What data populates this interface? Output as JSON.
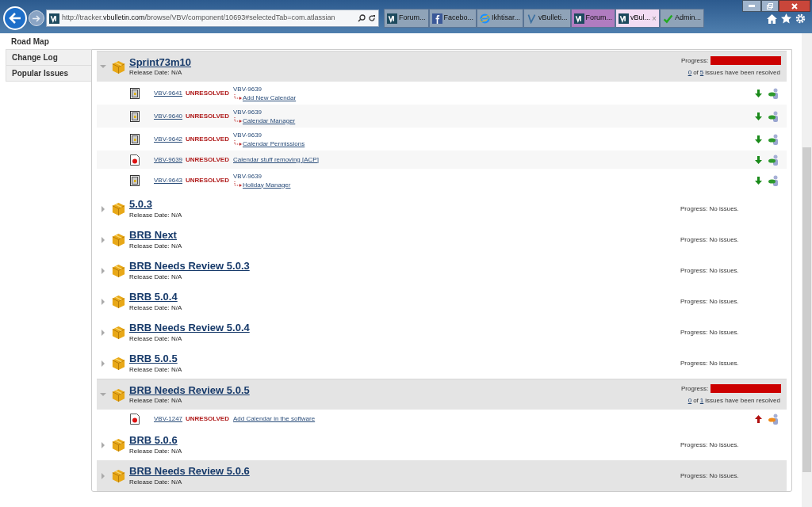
{
  "browser": {
    "url_host": "http://tracker.",
    "url_domain": "vbulletin.com",
    "url_path": "/browse/VBV/component/10693#selectedTab=com.atlassian",
    "tabs": [
      {
        "label": "Forum...",
        "selected": false,
        "color": "#8fa3b8",
        "kind": "vb"
      },
      {
        "label": "Facebo...",
        "selected": false,
        "color": "#8fa3b8",
        "kind": "fb"
      },
      {
        "label": "Ikhtisar...",
        "selected": false,
        "color": "#8fa3b8",
        "kind": "ie"
      },
      {
        "label": "vBulleti...",
        "selected": false,
        "color": "#8fa3b8",
        "kind": "vb2"
      },
      {
        "label": "Forum...",
        "selected": false,
        "color": "#b07cc0",
        "kind": "vb"
      },
      {
        "label": "vBul...",
        "selected": true,
        "color": "#f3ddf3",
        "kind": "vb",
        "close": "×"
      },
      {
        "label": "Admin...",
        "selected": false,
        "color": "#8fa3b8",
        "kind": "check"
      }
    ]
  },
  "sidebar": {
    "items": [
      {
        "label": "Road Map",
        "selected": true
      },
      {
        "label": "Change Log",
        "selected": false
      },
      {
        "label": "Popular Issues",
        "selected": false
      }
    ]
  },
  "versions": [
    {
      "name": "Sprint73m10",
      "release": "Release Date: N/A",
      "expanded": true,
      "shaded": true,
      "progress_label": "Progress:",
      "level": 0,
      "resolved": "0",
      "of": "of",
      "total": "5",
      "resolved_suffix": "issues have been resolved",
      "issues": [
        {
          "kind": "subtask",
          "key": "VBV-9641",
          "status": "UNRESOLVED",
          "parent": "VBV-9639",
          "summary": "Add New Calendar",
          "priority": {
            "kind": "minor"
          }
        },
        {
          "kind": "subtask",
          "key": "VBV-9640",
          "status": "UNRESOLVED",
          "parent": "VBV-9639",
          "summary": "Calendar Manager",
          "priority": {
            "kind": "minor"
          }
        },
        {
          "kind": "subtask",
          "key": "VBV-9642",
          "status": "UNRESOLVED",
          "parent": "VBV-9639",
          "summary": "Calendar Permissions",
          "priority": {
            "kind": "minor"
          }
        },
        {
          "kind": "bug",
          "key": "VBV-9639",
          "status": "UNRESOLVED",
          "summary": "Calendar stuff removing [ACP]",
          "priority": {
            "kind": "minor"
          }
        },
        {
          "kind": "subtask",
          "key": "VBV-9643",
          "status": "UNRESOLVED",
          "parent": "VBV-9639",
          "summary": "Holiday Manager",
          "priority": {
            "kind": "minor"
          }
        }
      ]
    },
    {
      "name": "5.0.3",
      "release": "Release Date: N/A",
      "expanded": false,
      "shaded": false,
      "progress_label": "Progress: No issues."
    },
    {
      "name": "BRB Next",
      "release": "Release Date: N/A",
      "expanded": false,
      "shaded": false,
      "progress_label": "Progress: No issues."
    },
    {
      "name": "BRB Needs Review 5.0.3",
      "release": "Release Date: N/A",
      "expanded": false,
      "shaded": false,
      "progress_label": "Progress: No issues."
    },
    {
      "name": "BRB 5.0.4",
      "release": "Release Date: N/A",
      "expanded": false,
      "shaded": false,
      "progress_label": "Progress: No issues."
    },
    {
      "name": "BRB Needs Review 5.0.4",
      "release": "Release Date: N/A",
      "expanded": false,
      "shaded": false,
      "progress_label": "Progress: No issues."
    },
    {
      "name": "BRB 5.0.5",
      "release": "Release Date: N/A",
      "expanded": false,
      "shaded": false,
      "progress_label": "Progress: No issues."
    },
    {
      "name": "BRB Needs Review 5.0.5",
      "release": "Release Date: N/A",
      "expanded": true,
      "shaded": true,
      "progress_label": "Progress:",
      "level": 0,
      "resolved": "0",
      "of": "of",
      "total": "1",
      "resolved_suffix": "issues have been resolved",
      "issues": [
        {
          "kind": "bug",
          "key": "VBV-1247",
          "status": "UNRESOLVED",
          "summary": "Add Calendar in the software",
          "priority": {
            "kind": "major"
          }
        }
      ]
    },
    {
      "name": "BRB 5.0.6",
      "release": "Release Date: N/A",
      "expanded": false,
      "shaded": false,
      "progress_label": "Progress: No issues."
    },
    {
      "name": "BRB Needs Review 5.0.6",
      "release": "Release Date: N/A",
      "expanded": false,
      "shaded": true,
      "progress_label": "Progress: No issues."
    }
  ]
}
